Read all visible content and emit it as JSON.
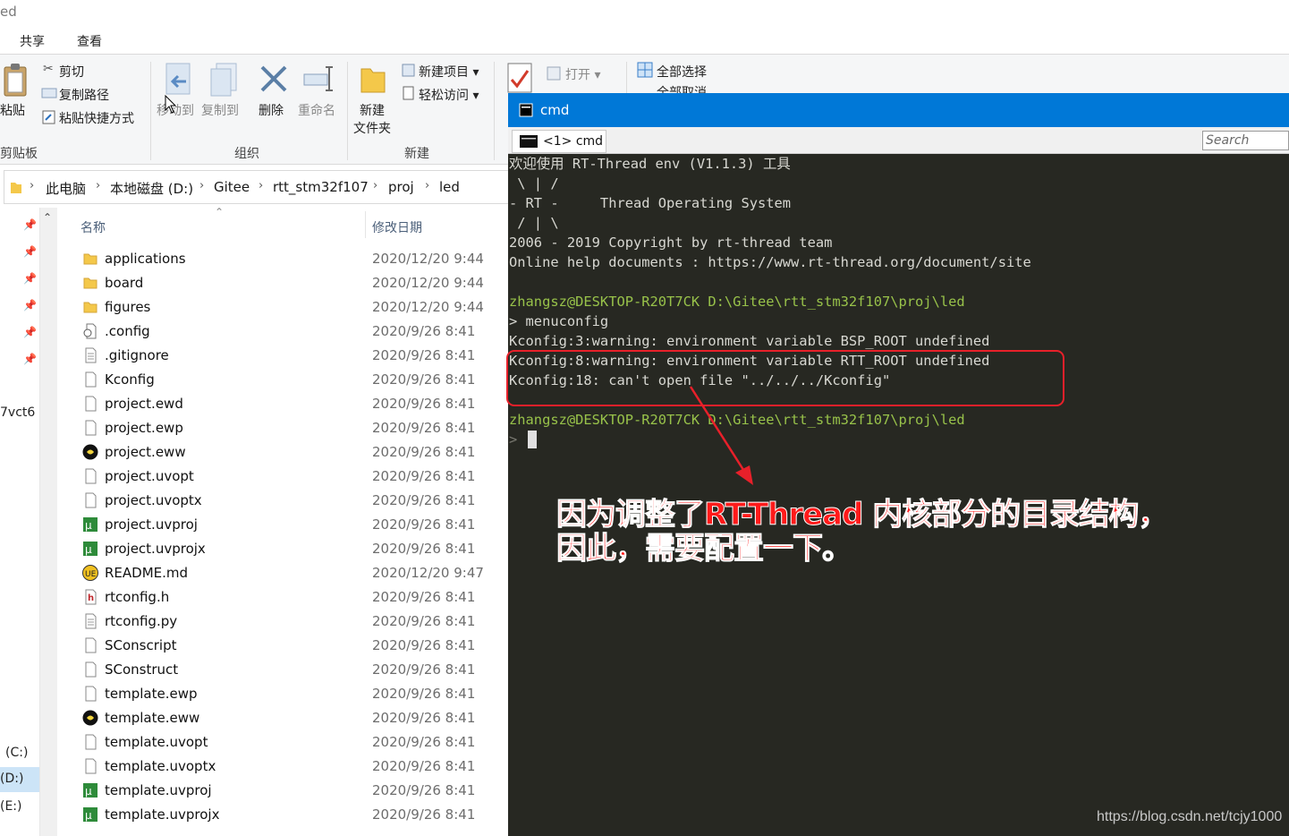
{
  "window": {
    "title_fragment": "ed"
  },
  "tabs": [
    {
      "label": "共享"
    },
    {
      "label": "查看"
    }
  ],
  "ribbon": {
    "clipboard": {
      "paste": "粘贴",
      "cut": "剪切",
      "copy_path": "复制路径",
      "paste_shortcut": "粘贴快捷方式",
      "group": "剪贴板"
    },
    "organize": {
      "move_to": "移动到",
      "copy_to": "复制到",
      "delete": "删除",
      "rename": "重命名",
      "group": "组织"
    },
    "new": {
      "new_folder_line1": "新建",
      "new_folder_line2": "文件夹",
      "new_item": "新建项目 ▾",
      "easy_access": "轻松访问 ▾",
      "group": "新建"
    },
    "open": {
      "open": "打开 ▾"
    },
    "select": {
      "select_all": "全部选择",
      "select_none": "全部取消"
    }
  },
  "breadcrumb": [
    "此电脑",
    "本地磁盘 (D:)",
    "Gitee",
    "rtt_stm32f107",
    "proj",
    "led"
  ],
  "nav": {
    "partial_item": "7vct6",
    "drives": [
      "(C:)",
      "(D:)",
      "(E:)"
    ]
  },
  "columns": {
    "name": "名称",
    "date": "修改日期"
  },
  "files": [
    {
      "name": "applications",
      "date": "2020/12/20 9:44",
      "type": "folder"
    },
    {
      "name": "board",
      "date": "2020/12/20 9:44",
      "type": "folder"
    },
    {
      "name": "figures",
      "date": "2020/12/20 9:44",
      "type": "folder"
    },
    {
      "name": ".config",
      "date": "2020/9/26 8:41",
      "type": "config"
    },
    {
      "name": ".gitignore",
      "date": "2020/9/26 8:41",
      "type": "text"
    },
    {
      "name": "Kconfig",
      "date": "2020/9/26 8:41",
      "type": "file"
    },
    {
      "name": "project.ewd",
      "date": "2020/9/26 8:41",
      "type": "file"
    },
    {
      "name": "project.ewp",
      "date": "2020/9/26 8:41",
      "type": "file"
    },
    {
      "name": "project.eww",
      "date": "2020/9/26 8:41",
      "type": "iar"
    },
    {
      "name": "project.uvopt",
      "date": "2020/9/26 8:41",
      "type": "file"
    },
    {
      "name": "project.uvoptx",
      "date": "2020/9/26 8:41",
      "type": "file"
    },
    {
      "name": "project.uvproj",
      "date": "2020/9/26 8:41",
      "type": "keil"
    },
    {
      "name": "project.uvprojx",
      "date": "2020/9/26 8:41",
      "type": "keil"
    },
    {
      "name": "README.md",
      "date": "2020/12/20 9:47",
      "type": "md"
    },
    {
      "name": "rtconfig.h",
      "date": "2020/9/26 8:41",
      "type": "header"
    },
    {
      "name": "rtconfig.py",
      "date": "2020/9/26 8:41",
      "type": "text"
    },
    {
      "name": "SConscript",
      "date": "2020/9/26 8:41",
      "type": "file"
    },
    {
      "name": "SConstruct",
      "date": "2020/9/26 8:41",
      "type": "file"
    },
    {
      "name": "template.ewp",
      "date": "2020/9/26 8:41",
      "type": "file"
    },
    {
      "name": "template.eww",
      "date": "2020/9/26 8:41",
      "type": "iar"
    },
    {
      "name": "template.uvopt",
      "date": "2020/9/26 8:41",
      "type": "file"
    },
    {
      "name": "template.uvoptx",
      "date": "2020/9/26 8:41",
      "type": "file"
    },
    {
      "name": "template.uvproj",
      "date": "2020/9/26 8:41",
      "type": "keil"
    },
    {
      "name": "template.uvprojx",
      "date": "2020/9/26 8:41",
      "type": "keil"
    }
  ],
  "cmd": {
    "title": "cmd",
    "tab": "<1> cmd",
    "search_placeholder": "Search",
    "lines": [
      {
        "text": "欢迎使用 RT-Thread env (V1.1.3) 工具",
        "style": "normal"
      },
      {
        "text": " \\ | /",
        "style": "normal"
      },
      {
        "text": "- RT -     Thread Operating System",
        "style": "normal"
      },
      {
        "text": " / | \\",
        "style": "normal"
      },
      {
        "text": "2006 - 2019 Copyright by rt-thread team",
        "style": "normal"
      },
      {
        "text": "Online help documents : https://www.rt-thread.org/document/site",
        "style": "normal"
      },
      {
        "text": "",
        "style": "normal"
      },
      {
        "text": "zhangsz@DESKTOP-R20T7CK D:\\Gitee\\rtt_stm32f107\\proj\\led",
        "style": "prompt"
      },
      {
        "text": "> menuconfig",
        "style": "normal"
      },
      {
        "text": "Kconfig:3:warning: environment variable BSP_ROOT undefined",
        "style": "normal"
      },
      {
        "text": "Kconfig:8:warning: environment variable RTT_ROOT undefined",
        "style": "normal"
      },
      {
        "text": "Kconfig:18: can't open file \"../../../Kconfig\"",
        "style": "normal"
      },
      {
        "text": "",
        "style": "normal"
      },
      {
        "text": "zhangsz@DESKTOP-R20T7CK D:\\Gitee\\rtt_stm32f107\\proj\\led",
        "style": "prompt"
      },
      {
        "text": ">",
        "style": "dim"
      }
    ]
  },
  "annotation": {
    "line1": "因为调整了RT-Thread 内核部分的目录结构，",
    "line2": "因此，需要配置一下。",
    "color": "#ff1a1a"
  },
  "watermark": "https://blog.csdn.net/tcjy1000",
  "colors": {
    "cmd_titlebar": "#0078d7",
    "console_bg": "#272822",
    "prompt_green": "#98c24a",
    "highlight_red": "#e8202a"
  }
}
